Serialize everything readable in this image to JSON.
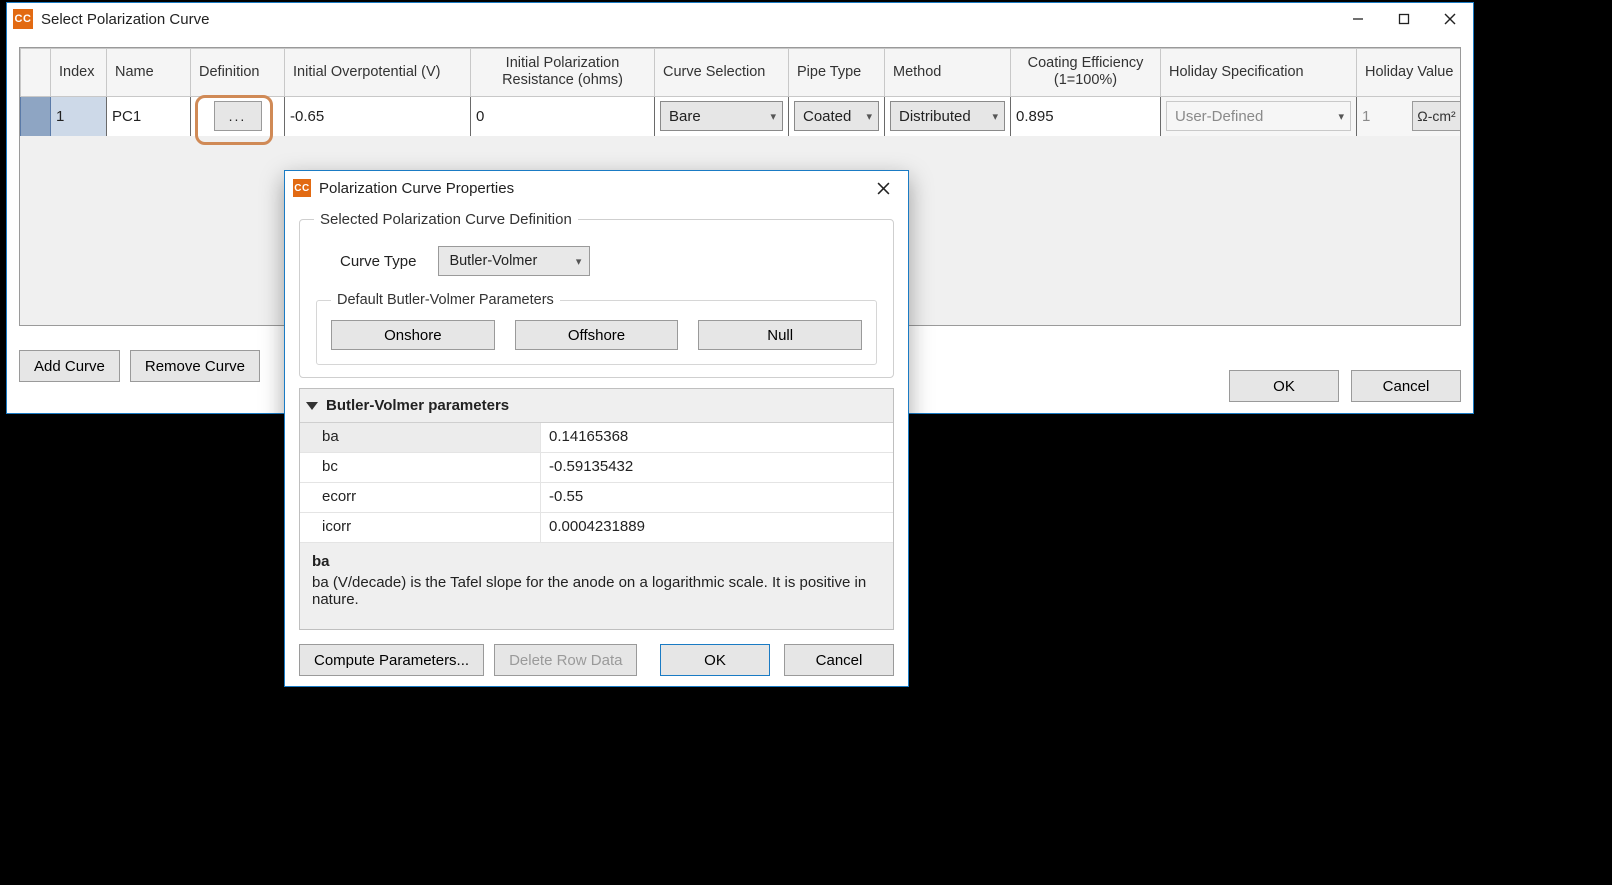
{
  "parent": {
    "title": "Select Polarization Curve",
    "columns": [
      "Index",
      "Name",
      "Definition",
      "Initial Overpotential (V)",
      "Initial Polarization Resistance (ohms)",
      "Curve Selection",
      "Pipe Type",
      "Method",
      "Coating Efficiency (1=100%)",
      "Holiday Specification",
      "Holiday Value"
    ],
    "row": {
      "index": "1",
      "name": "PC1",
      "definition_btn": "...",
      "initial_overpotential": "-0.65",
      "initial_pol_resistance": "0",
      "curve_selection": "Bare",
      "pipe_type": "Coated",
      "method": "Distributed",
      "coating_efficiency": "0.895",
      "holiday_specification": "User-Defined",
      "holiday_value": "1",
      "holiday_unit": "Ω-cm²"
    },
    "buttons": {
      "add": "Add Curve",
      "remove": "Remove Curve",
      "ok": "OK",
      "cancel": "Cancel"
    }
  },
  "dialog": {
    "title": "Polarization Curve Properties",
    "group_label": "Selected Polarization Curve Definition",
    "curve_type_label": "Curve Type",
    "curve_type_value": "Butler-Volmer",
    "defaults_label": "Default Butler-Volmer Parameters",
    "default_buttons": {
      "onshore": "Onshore",
      "offshore": "Offshore",
      "null": "Null"
    },
    "propgrid": {
      "header": "Butler-Volmer parameters",
      "rows": [
        {
          "name": "ba",
          "value": "0.14165368"
        },
        {
          "name": "bc",
          "value": "-0.59135432"
        },
        {
          "name": "ecorr",
          "value": "-0.55"
        },
        {
          "name": "icorr",
          "value": "0.0004231889"
        }
      ]
    },
    "desc": {
      "head": "ba",
      "body": "ba (V/decade) is the Tafel slope for the anode on a logarithmic scale. It is positive in nature."
    },
    "bottom": {
      "compute": "Compute Parameters...",
      "delete": "Delete Row Data",
      "ok": "OK",
      "cancel": "Cancel"
    }
  },
  "app_icon_text": "CC"
}
